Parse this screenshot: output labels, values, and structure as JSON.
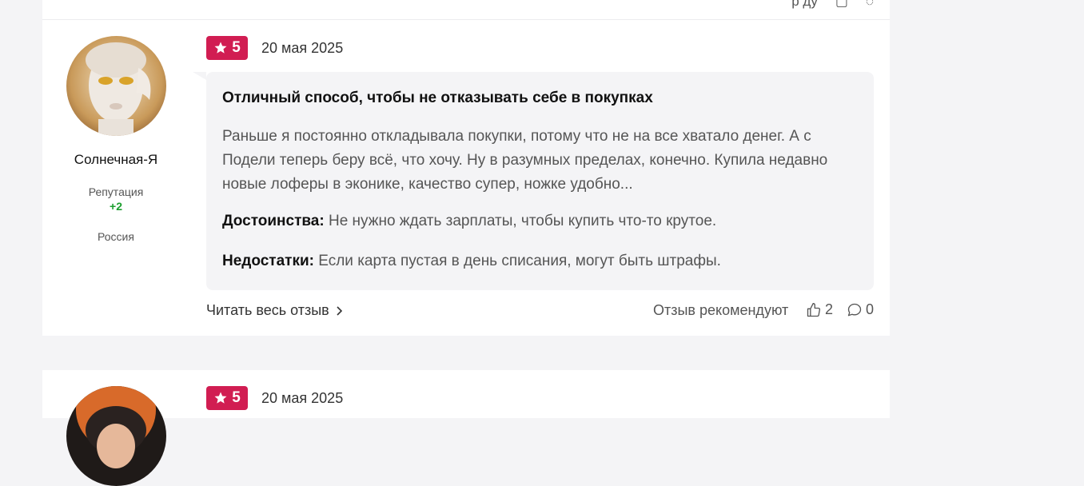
{
  "top_card": {
    "ghost_text": "р    ду"
  },
  "review": {
    "user": {
      "name": "Солнечная-Я",
      "reputation_label": "Репутация",
      "reputation_value": "+2",
      "country": "Россия"
    },
    "rating": "5",
    "date": "20 мая 2025",
    "title": "Отличный способ, чтобы не отказывать себе в покупках",
    "body": "Раньше я постоянно откладывала покупки, потому что не на все хватало денег. А с Подели теперь беру всё, что хочу. Ну в разумных пределах, конечно. Купила недавно новые лоферы в эконике, качество супер, ножке удобно...",
    "pros_label": "Достоинства:",
    "pros_text": "Не нужно ждать зарплаты, чтобы купить что-то крутое.",
    "cons_label": "Недостатки:",
    "cons_text": "Если карта пустая в день списания, могут быть штрафы.",
    "read_more": "Читать весь отзыв",
    "recommend_label": "Отзыв рекомендуют",
    "likes": "2",
    "comments": "0"
  },
  "next_review": {
    "rating": "5",
    "date": "20 мая 2025"
  },
  "colors": {
    "rating_badge": "#d11d52",
    "reputation": "#1b9e2e",
    "bubble": "#f4f4f6"
  }
}
